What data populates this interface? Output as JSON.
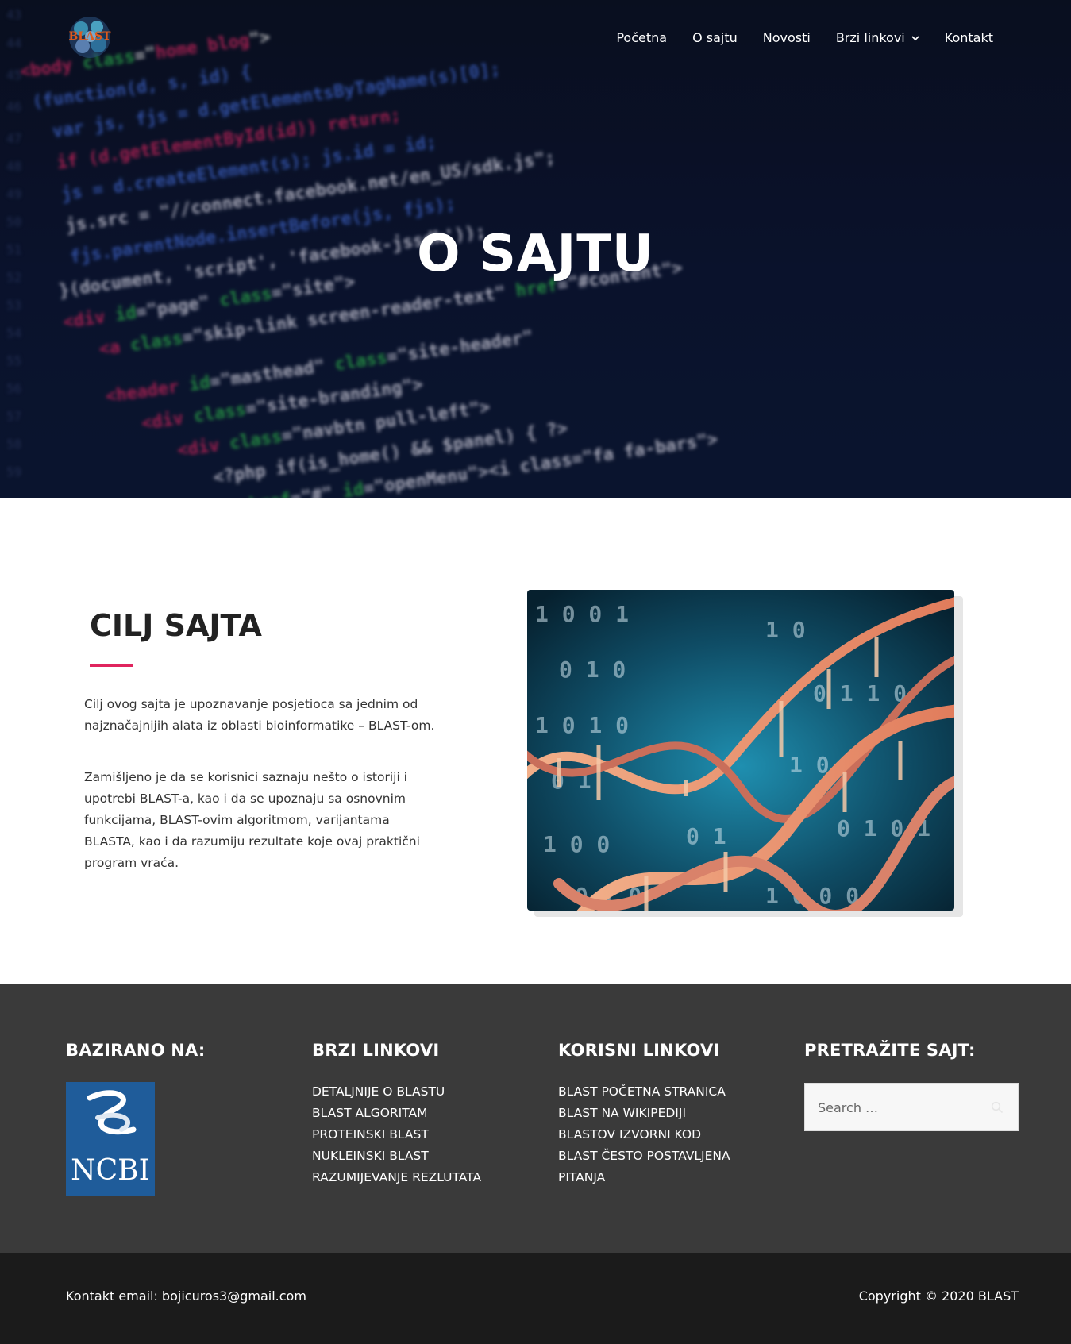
{
  "header": {
    "logo_text": "BLAST",
    "nav": [
      "Početna",
      "O sajtu",
      "Novosti",
      "Brzi linkovi",
      "Kontakt"
    ]
  },
  "hero": {
    "title": "O SAJTU"
  },
  "main": {
    "section_title": "CILJ SAJTA",
    "paragraph_1": "Cilj ovog sajta je upoznavanje posjetioca sa jednim od najznačajnijih alata iz oblasti bioinformatike – BLAST-om.",
    "paragraph_2": "Zamišljeno je da se korisnici  saznaju nešto o istoriji i upotrebi BLAST-a, kao i da se upoznaju sa osnovnim funkcijama, BLAST-ovim algoritmom, varijantama BLASTA, kao i da razumiju rezultate koje ovaj praktični program vraća."
  },
  "footer_widgets": {
    "based_on": {
      "title": "BAZIRANO NA:",
      "logo_text": "NCBI"
    },
    "quick_links": {
      "title": "BRZI LINKOVI",
      "items": [
        "DETALJNIJE O BLASTU",
        "BLAST ALGORITAM",
        "PROTEINSKI BLAST",
        "NUKLEINSKI BLAST",
        "RAZUMIJEVANJE REZLUTATA"
      ]
    },
    "useful_links": {
      "title": "KORISNI LINKOVI",
      "items": [
        "BLAST POČETNA STRANICA",
        "BLAST NA WIKIPEDIJI",
        "BLASTOV IZVORNI KOD",
        "BLAST ČESTO POSTAVLJENA",
        "PITANJA"
      ]
    },
    "search": {
      "title": "PRETRAŽITE SAJT:",
      "placeholder": "Search …"
    }
  },
  "footer_bar": {
    "contact": "Kontakt email: bojicuros3@gmail.com",
    "copyright": "Copyright © 2020 BLAST"
  },
  "colors": {
    "accent": "#e0245e",
    "footer_widgets_bg": "#3a3a3a",
    "footer_bar_bg": "#1b1b1b",
    "ncbi_blue": "#1f5c9a"
  }
}
